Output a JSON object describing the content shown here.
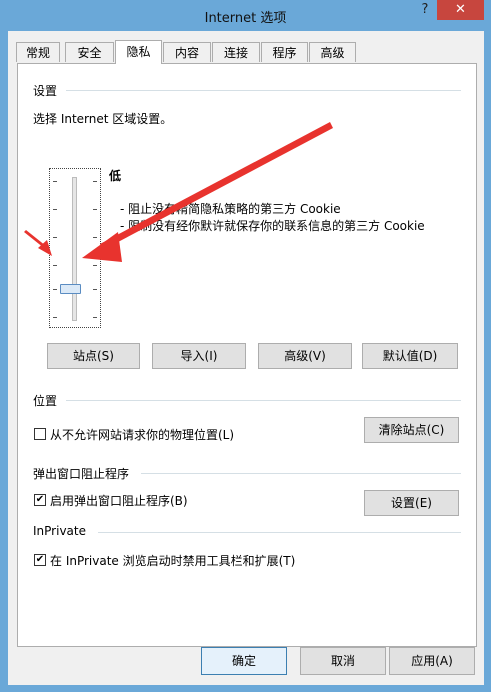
{
  "window": {
    "title": "Internet 选项",
    "help_label": "?",
    "close_label": "✕"
  },
  "tabs": [
    {
      "label": "常规"
    },
    {
      "label": "安全"
    },
    {
      "label": "隐私"
    },
    {
      "label": "内容"
    },
    {
      "label": "连接"
    },
    {
      "label": "程序"
    },
    {
      "label": "高级"
    }
  ],
  "settings": {
    "group_label": "设置",
    "instruction": "选择 Internet 区域设置。",
    "level_name": "低",
    "bullet_1": "- 阻止没有精简隐私策略的第三方 Cookie",
    "bullet_2": "- 限制没有经你默许就保存你的联系信息的第三方 Cookie",
    "slider_level": 2,
    "slider_levels": 6,
    "buttons": {
      "sites": "站点(S)",
      "import": "导入(I)",
      "advanced": "高级(V)",
      "default": "默认值(D)"
    }
  },
  "location": {
    "group_label": "位置",
    "checkbox_label": "从不允许网站请求你的物理位置(L)",
    "checked": false,
    "clear_button": "清除站点(C)"
  },
  "popup": {
    "group_label": "弹出窗口阻止程序",
    "checkbox_label": "启用弹出窗口阻止程序(B)",
    "checked": true,
    "settings_button": "设置(E)"
  },
  "inprivate": {
    "group_label": "InPrivate",
    "checkbox_label": "在 InPrivate 浏览启动时禁用工具栏和扩展(T)",
    "checked": true
  },
  "footer": {
    "ok": "确定",
    "cancel": "取消",
    "apply": "应用(A)"
  },
  "colors": {
    "titlebar": "#6aa8d8",
    "close_button": "#c7463e",
    "annotation_arrow": "#e8332e"
  }
}
